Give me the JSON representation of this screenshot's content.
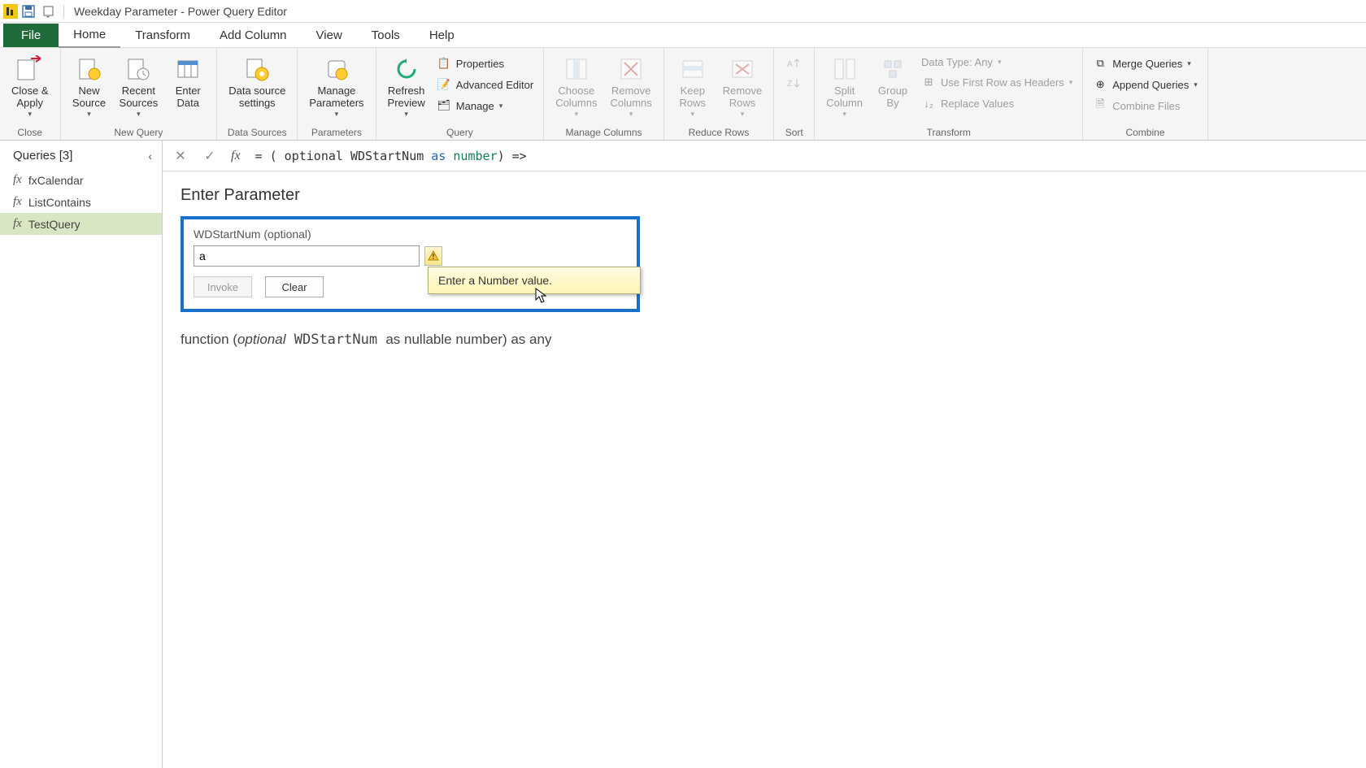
{
  "title": "Weekday Parameter - Power Query Editor",
  "menu": {
    "file": "File",
    "home": "Home",
    "transform": "Transform",
    "addColumn": "Add Column",
    "view": "View",
    "tools": "Tools",
    "help": "Help"
  },
  "ribbon": {
    "closeApply": "Close &\nApply",
    "closeGroup": "Close",
    "newSource": "New\nSource",
    "recentSources": "Recent\nSources",
    "enterData": "Enter\nData",
    "newQueryGroup": "New Query",
    "dataSourceSettings": "Data source\nsettings",
    "dataSourcesGroup": "Data Sources",
    "manageParameters": "Manage\nParameters",
    "parametersGroup": "Parameters",
    "refreshPreview": "Refresh\nPreview",
    "properties": "Properties",
    "advancedEditor": "Advanced Editor",
    "manage": "Manage",
    "queryGroup": "Query",
    "chooseColumns": "Choose\nColumns",
    "removeColumns": "Remove\nColumns",
    "manageColumnsGroup": "Manage Columns",
    "keepRows": "Keep\nRows",
    "removeRows": "Remove\nRows",
    "reduceRowsGroup": "Reduce Rows",
    "sortGroup": "Sort",
    "splitColumn": "Split\nColumn",
    "groupBy": "Group\nBy",
    "dataType": "Data Type: Any",
    "firstRowHeaders": "Use First Row as Headers",
    "replaceValues": "Replace Values",
    "transformGroup": "Transform",
    "mergeQueries": "Merge Queries",
    "appendQueries": "Append Queries",
    "combineFiles": "Combine Files",
    "combineGroup": "Combine"
  },
  "queries": {
    "header": "Queries [3]",
    "items": [
      "fxCalendar",
      "ListContains",
      "TestQuery"
    ]
  },
  "formula": {
    "prefix": "= ( optional WDStartNum ",
    "as": "as",
    "type": "number",
    "suffix": ") =>"
  },
  "param": {
    "heading": "Enter Parameter",
    "label": "WDStartNum (optional)",
    "value": "a",
    "tooltip": "Enter a Number value.",
    "invoke": "Invoke",
    "clear": "Clear"
  },
  "signature": {
    "p1": "function (",
    "p2": "optional",
    "p3": " WDStartNum ",
    "p4": "as nullable number) as any"
  }
}
